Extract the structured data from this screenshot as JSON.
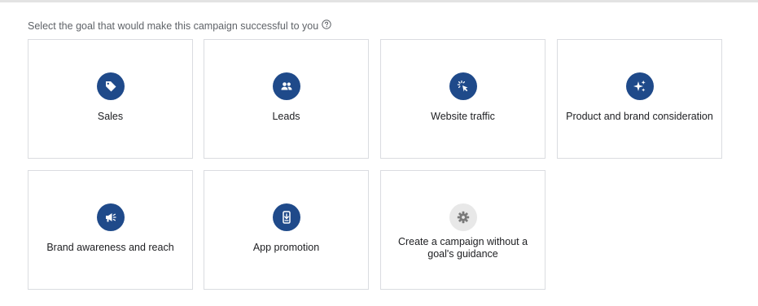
{
  "prompt": {
    "text": "Select the goal that would make this campaign successful to you",
    "help_icon": "help-circle-icon"
  },
  "goals": [
    {
      "label": "Sales",
      "icon": "tag-icon",
      "icon_color": "#1f4a8a"
    },
    {
      "label": "Leads",
      "icon": "people-icon",
      "icon_color": "#1f4a8a"
    },
    {
      "label": "Website traffic",
      "icon": "cursor-click-icon",
      "icon_color": "#1f4a8a"
    },
    {
      "label": "Product and brand consideration",
      "icon": "sparkle-icon",
      "icon_color": "#1f4a8a"
    },
    {
      "label": "Brand awareness and reach",
      "icon": "megaphone-icon",
      "icon_color": "#1f4a8a"
    },
    {
      "label": "App promotion",
      "icon": "phone-download-icon",
      "icon_color": "#1f4a8a"
    },
    {
      "label": "Create a campaign without a goal's guidance",
      "icon": "gear-icon",
      "icon_color": "#e8e8e8"
    }
  ]
}
